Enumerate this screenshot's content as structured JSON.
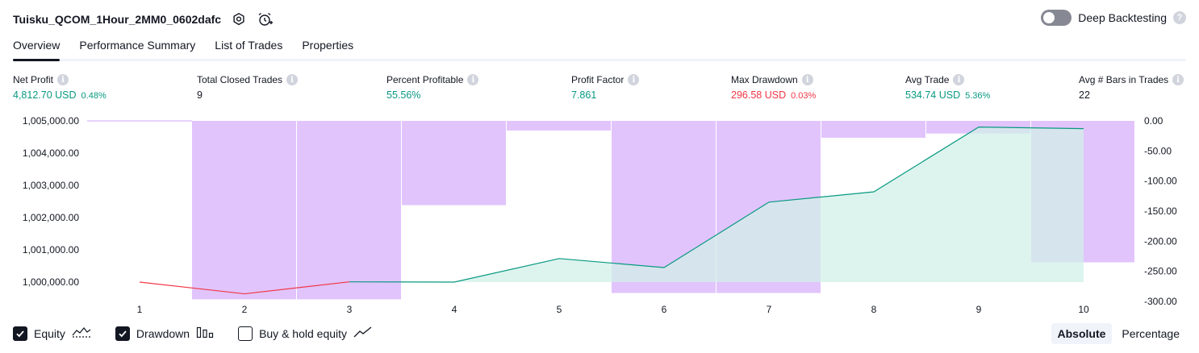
{
  "header": {
    "strategy_title": "Tuisku_QCOM_1Hour_2MM0_0602dafc",
    "settings_icon": "gear-icon",
    "alert_icon": "alarm-clock-add-icon"
  },
  "deep_backtesting": {
    "label": "Deep Backtesting",
    "enabled": false,
    "help": "?"
  },
  "tabs": [
    {
      "label": "Overview",
      "active": true
    },
    {
      "label": "Performance Summary",
      "active": false
    },
    {
      "label": "List of Trades",
      "active": false
    },
    {
      "label": "Properties",
      "active": false
    }
  ],
  "metrics": {
    "net_profit": {
      "label": "Net Profit",
      "value": "4,812.70 USD",
      "pct": "0.48%"
    },
    "total_closed_trades": {
      "label": "Total Closed Trades",
      "value": "9"
    },
    "percent_profitable": {
      "label": "Percent Profitable",
      "value": "55.56%"
    },
    "profit_factor": {
      "label": "Profit Factor",
      "value": "7.861"
    },
    "max_drawdown": {
      "label": "Max Drawdown",
      "value": "296.58 USD",
      "pct": "0.03%"
    },
    "avg_trade": {
      "label": "Avg Trade",
      "value": "534.74 USD",
      "pct": "5.36%"
    },
    "avg_bars": {
      "label": "Avg # Bars in Trades",
      "value": "22"
    },
    "info": "i"
  },
  "chart_data": {
    "type": "area",
    "x": [
      1,
      2,
      3,
      4,
      5,
      6,
      7,
      8,
      9,
      10
    ],
    "series": [
      {
        "axis": "left",
        "start": 1000000,
        "values": [
          999994,
          999636,
          1000008,
          1000000,
          1000730,
          1000450,
          1002480,
          1002800,
          1004810,
          1004760
        ]
      },
      {
        "axis": "right",
        "values": [
          -296.5,
          -296.5,
          -140,
          -16,
          -286,
          -286,
          -28,
          -21,
          -235
        ]
      }
    ],
    "left_axis": {
      "min": 999650,
      "max": 1005000,
      "ticks": [
        "1,005,000.00",
        "1,004,000.00",
        "1,003,000.00",
        "1,002,000.00",
        "1,001,000.00",
        "1,000,000.00"
      ],
      "tick_values": [
        1005000,
        1004000,
        1003000,
        1002000,
        1001000,
        1000000
      ]
    },
    "right_axis": {
      "min": -300,
      "max": 0,
      "ticks": [
        "0.00",
        "-50.00",
        "-100.00",
        "-150.00",
        "-200.00",
        "-250.00",
        "-300.00"
      ],
      "tick_values": [
        0,
        -50,
        -100,
        -150,
        -200,
        -250,
        -300
      ]
    },
    "x_ticks": [
      "1",
      "2",
      "3",
      "4",
      "5",
      "6",
      "7",
      "8",
      "9",
      "10"
    ],
    "colors": {
      "equity_up": "#089981",
      "equity_down": "#f23645",
      "equity_fill": "#d2f0e8",
      "drawdown_bar": "#e1c4fc",
      "baseline": "#e1c4fc"
    }
  },
  "legend": [
    {
      "label": "Equity",
      "checked": true,
      "icon": "equity-line-icon"
    },
    {
      "label": "Drawdown",
      "checked": true,
      "icon": "drawdown-bars-icon"
    },
    {
      "label": "Buy & hold equity",
      "checked": false,
      "icon": "buy-hold-line-icon"
    }
  ],
  "modes": [
    {
      "label": "Absolute",
      "active": true
    },
    {
      "label": "Percentage",
      "active": false
    }
  ]
}
